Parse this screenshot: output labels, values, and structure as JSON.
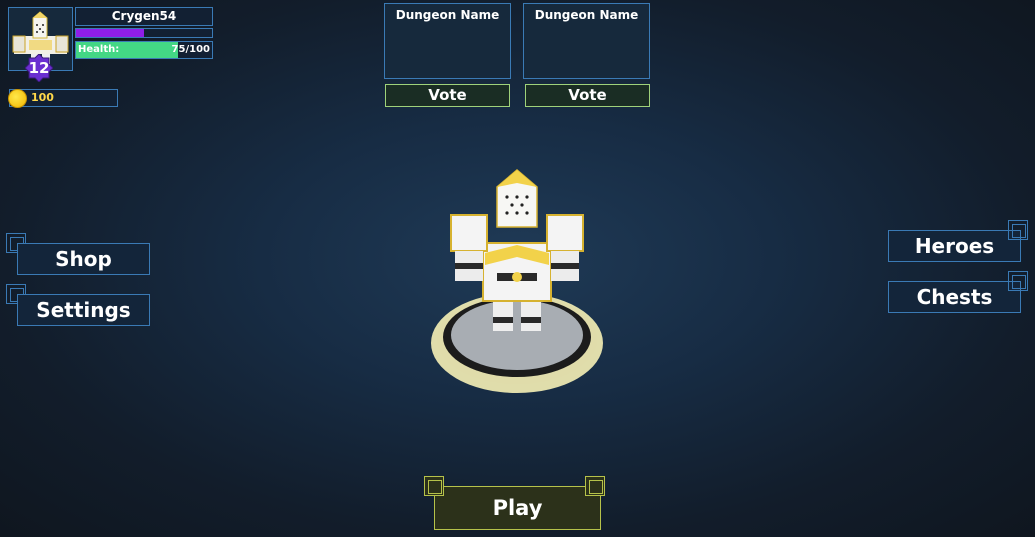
{
  "player": {
    "name": "Crygen54",
    "level": "12",
    "xp_fraction": 0.5,
    "health_label": "Health:",
    "health_value": "75/100",
    "health_fraction": 0.75,
    "coins": "100"
  },
  "dungeon_vote": [
    {
      "name": "Dungeon Name",
      "vote_label": "Vote"
    },
    {
      "name": "Dungeon Name",
      "vote_label": "Vote"
    }
  ],
  "menu_left": {
    "shop": "Shop",
    "settings": "Settings"
  },
  "menu_right": {
    "heroes": "Heroes",
    "chests": "Chests"
  },
  "play_label": "Play",
  "colors": {
    "panel_border": "#3a7ab5",
    "xp": "#8f1ee8",
    "health": "#43d785",
    "coin": "#ffd84a",
    "vote_border": "#9fd27a",
    "play_border": "#b6c24a"
  },
  "icons": {
    "avatar": "knight-avatar-icon",
    "coin": "coin-icon",
    "level": "level-badge-icon"
  }
}
